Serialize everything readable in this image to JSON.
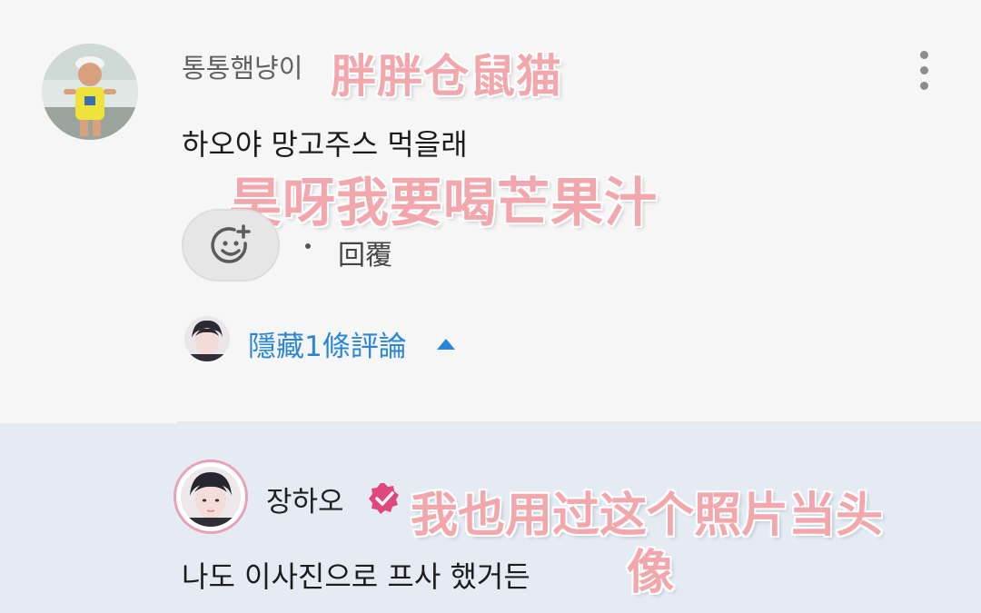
{
  "comment": {
    "username": "통통햄냥이",
    "username_overlay": "胖胖仓鼠猫",
    "text": "하오야 망고주스 먹을래",
    "text_overlay": "昊呀我要喝芒果汁",
    "reply_label": "回覆",
    "hidden_comments_label": "隱藏1條評論",
    "avatar_icon": "child-photo-avatar",
    "menu_icon": "more-vertical-icon",
    "reaction_icon": "add-reaction-icon"
  },
  "reply": {
    "username": "장하오",
    "text": "나도 이사진으로 프사 했거든",
    "overlay_line1": "我也用过这个照片当头",
    "overlay_line2": "像",
    "verified_icon": "verified-badge-icon",
    "avatar_icon": "profile-photo-avatar"
  },
  "colors": {
    "link_blue": "#2a86d8",
    "overlay_pink": "#f2a7ad",
    "verified_pink": "#e0487d",
    "reply_bg": "#e4ebf3"
  }
}
